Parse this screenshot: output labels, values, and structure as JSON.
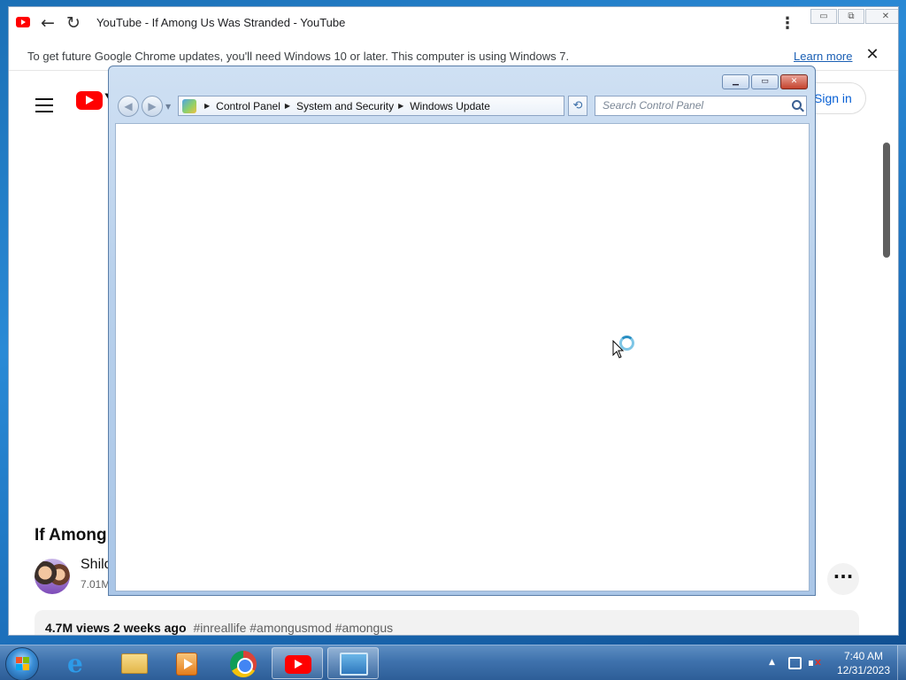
{
  "chrome": {
    "tab_title": "YouTube - If Among Us Was Stranded - YouTube",
    "menu_glyph": "⋮",
    "sys_buttons": {
      "minimize": "▭",
      "restore": "⧉",
      "close": "✕"
    },
    "infobar": {
      "message": "To get future Google Chrome updates, you'll need Windows 10 or later. This computer is using Windows 7.",
      "link": "Learn more",
      "close_glyph": "✕"
    }
  },
  "youtube": {
    "logo_letter": "Y",
    "sign_in": "Sign in",
    "video_title": "If Among",
    "channel_name": "Shilo",
    "channel_subs": "7.01M",
    "more_glyph": "···",
    "description": {
      "views": "4.7M views",
      "age": "2 weeks ago",
      "tags": "#inreallife #amongusmod #amongus"
    }
  },
  "control_panel": {
    "breadcrumbs": [
      "Control Panel",
      "System and Security",
      "Windows Update"
    ],
    "search_placeholder": "Search Control Panel",
    "caption_buttons": {
      "minimize": "▁",
      "maximize": "▭",
      "close": "✕"
    }
  },
  "taskbar": {
    "pinned": [
      "internet-explorer",
      "windows-explorer",
      "windows-media-player",
      "google-chrome",
      "youtube",
      "control-panel"
    ],
    "clock": {
      "time": "7:40 AM",
      "date": "12/31/2023"
    }
  },
  "colors": {
    "youtube_red": "#ff0000",
    "link_blue": "#1a5fb4",
    "taskbar_blue": "#3f72ad"
  }
}
